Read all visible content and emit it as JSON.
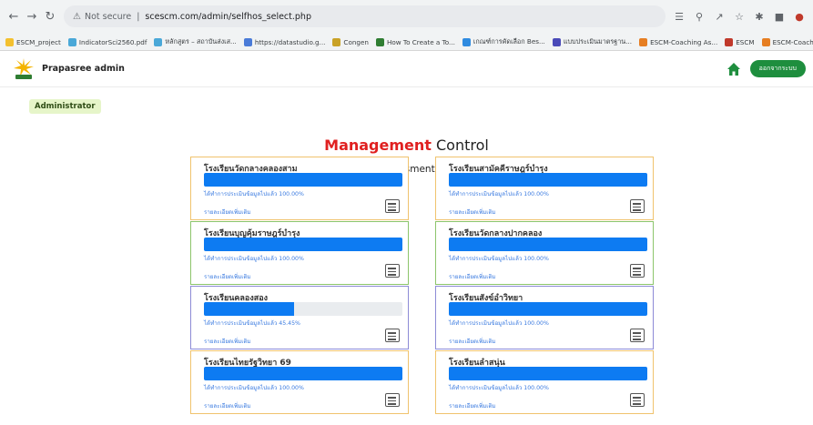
{
  "browser": {
    "url_warning": "Not secure",
    "url": "scescm.com/admin/selfhos_select.php",
    "bookmarks": [
      {
        "label": "ESCM_project",
        "color": "#f3c02f"
      },
      {
        "label": "IndicatorSci2560.pdf",
        "color": "#4aa8d8"
      },
      {
        "label": "หลักสูตร – สถาบันส่งเส...",
        "color": "#4aa8d8"
      },
      {
        "label": "https://datastudio.g...",
        "color": "#4a7bd8"
      },
      {
        "label": "Congen",
        "color": "#c9a227"
      },
      {
        "label": "How To Create a To...",
        "color": "#2f7d32"
      },
      {
        "label": "เกณฑ์การคัดเลือก Bes...",
        "color": "#2f8be0"
      },
      {
        "label": "แบบประเมินมาตรฐาน...",
        "color": "#4a4ab8"
      },
      {
        "label": "ESCM-Coaching As...",
        "color": "#e67e22"
      },
      {
        "label": "ESCM",
        "color": "#c0392b"
      },
      {
        "label": "ESCM-Coaching As...",
        "color": "#e67e22"
      }
    ]
  },
  "header": {
    "brand": "Prapasree admin",
    "logout_label": "ออกจากระบบ"
  },
  "role_badge": "Administrator",
  "title": {
    "accent": "Management",
    "rest": " Control"
  },
  "subtitle": "View Self-assessment response",
  "more_label": "รายละเอียดเพิ่มเติม",
  "schools": [
    {
      "name": "โรงเรียนวัดกลางคลองสาม",
      "status": "ได้ทำการประเมินข้อมูลไปแล้ว 100.00%",
      "progress": 100,
      "border": "#f0c36d"
    },
    {
      "name": "โรงเรียนสามัคคีราษฎร์บำรุง",
      "status": "ได้ทำการประเมินข้อมูลไปแล้ว 100.00%",
      "progress": 100,
      "border": "#f0c36d"
    },
    {
      "name": "โรงเรียนบุญคุ้มราษฎร์บำรุง",
      "status": "ได้ทำการประเมินข้อมูลไปแล้ว 100.00%",
      "progress": 100,
      "border": "#8cc56b"
    },
    {
      "name": "โรงเรียนวัดกลางปากคลอง",
      "status": "ได้ทำการประเมินข้อมูลไปแล้ว 100.00%",
      "progress": 100,
      "border": "#8cc56b"
    },
    {
      "name": "โรงเรียนคลองสอง",
      "status": "ได้ทำการประเมินข้อมูลไปแล้ว 45.45%",
      "progress": 45.45,
      "border": "#8d8bd6"
    },
    {
      "name": "โรงเรียนสังข์อำวิทยา",
      "status": "ได้ทำการประเมินข้อมูลไปแล้ว 100.00%",
      "progress": 100,
      "border": "#8d8bd6"
    },
    {
      "name": "โรงเรียนไทยรัฐวิทยา 69",
      "status": "ได้ทำการประเมินข้อมูลไปแล้ว 100.00%",
      "progress": 100,
      "border": "#f0c36d"
    },
    {
      "name": "โรงเรียนลำสนุ่น",
      "status": "ได้ทำการประเมินข้อมูลไปแล้ว 100.00%",
      "progress": 100,
      "border": "#f0c36d"
    }
  ]
}
